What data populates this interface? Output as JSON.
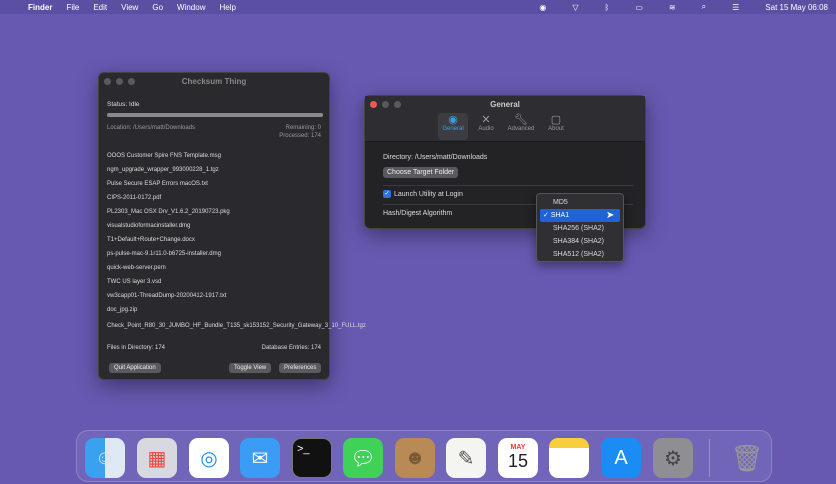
{
  "menubar": {
    "apple": "",
    "app": "Finder",
    "items": [
      "File",
      "Edit",
      "View",
      "Go",
      "Window",
      "Help"
    ],
    "clock": "Sat 15 May  06:08"
  },
  "checksum": {
    "title": "Checksum Thing",
    "status": "Status: Idle",
    "progress": 1.0,
    "location": "Location: /Users/matt/Downloads",
    "remaining": "Remaining: 0",
    "processed": "Processed: 174",
    "files": [
      "OOOS Customer Spire FNS Template.msg",
      "ngm_upgrade_wrapper_993000228_1.tgz",
      "Pulse Secure ESAP Errors macOS.txt",
      "CIPS-2011-0172.pdf",
      "PL2303_Mac OSX Drv_V1.6.2_20190723.pkg",
      "visualstudioformacinstaller.dmg",
      "T1+Default+Route+Change.docx",
      "ps-pulse-mac-9.1r11.0-b6725-installer.dmg",
      "quick-web-server.pem",
      "TWC US layer 3.vsd",
      "vw3capp01-ThreadDump-20200412-1917.txt",
      "doc_jpg.zip",
      "Check_Point_R80_30_JUMBO_HF_Bundle_T135_sk153152_Security_Gateway_3_10_FULL.tgz"
    ],
    "files_in_dir": "Files in Directory: 174",
    "db_entries": "Database Entries: 174",
    "quit": "Quit Application",
    "toggle": "Toggle View",
    "prefs": "Preferences"
  },
  "general": {
    "title": "General",
    "tabs": [
      "General",
      "Audio",
      "Advanced",
      "About"
    ],
    "directory": "Directory: /Users/matt/Downloads",
    "choose": "Choose Target Folder",
    "launch": "Launch Utility at Login",
    "hash_label": "Hash/Digest Algorithm",
    "options": [
      "MD5",
      "SHA1",
      "SHA256 (SHA2)",
      "SHA384 (SHA2)",
      "SHA512 (SHA2)"
    ],
    "selected": "SHA1"
  },
  "calendar": {
    "month": "MAY",
    "day": "15"
  }
}
